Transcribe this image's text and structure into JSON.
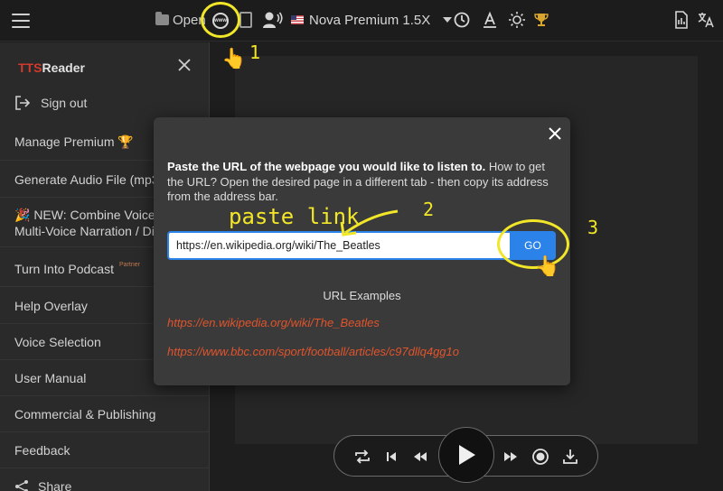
{
  "topbar": {
    "open_label": "Open",
    "voice_label": "Nova Premium 1.5X",
    "icons": [
      "hamburger-icon",
      "folder-icon",
      "globe-www-icon",
      "page-icon",
      "voice-icon",
      "us-flag-icon",
      "chevron-down-icon",
      "timer-icon",
      "font-icon",
      "brightness-icon",
      "trophy-icon",
      "document-icon",
      "translate-icon"
    ]
  },
  "annotations": {
    "step1": "1",
    "step2": "2",
    "step3": "3",
    "paste_link": "paste link",
    "highlight_color": "#f2e628"
  },
  "sidebar": {
    "brand_tts": "TTS",
    "brand_reader": "Reader",
    "sign_out": "Sign out",
    "items": [
      {
        "label": "Manage Premium 🏆"
      },
      {
        "label": "Generate Audio File (mp3)"
      },
      {
        "label": "🎉 NEW: Combine Voices",
        "label2": "Multi-Voice Narration / Di"
      },
      {
        "label": "Turn Into Podcast",
        "badge": "Partner"
      },
      {
        "label": "Help Overlay"
      },
      {
        "label": "Voice Selection"
      },
      {
        "label": "User Manual"
      },
      {
        "label": "Commercial & Publishing"
      },
      {
        "label": "Feedback"
      },
      {
        "label": "Share"
      }
    ]
  },
  "modal": {
    "desc_bold": "Paste the URL of the webpage you would like to listen to.",
    "desc_rest": " How to get the URL? Open the desired page in a different tab - then copy its address from the address bar.",
    "url_value": "https://en.wikipedia.org/wiki/The_Beatles",
    "go_label": "GO",
    "examples_title": "URL Examples",
    "examples": [
      "https://en.wikipedia.org/wiki/The_Beatles",
      "https://www.bbc.com/sport/football/articles/c97dllq4gg1o"
    ]
  },
  "colors": {
    "accent_blue": "#2b82e8",
    "link_orange": "#e0542c",
    "brand_red": "#d33a2c"
  }
}
